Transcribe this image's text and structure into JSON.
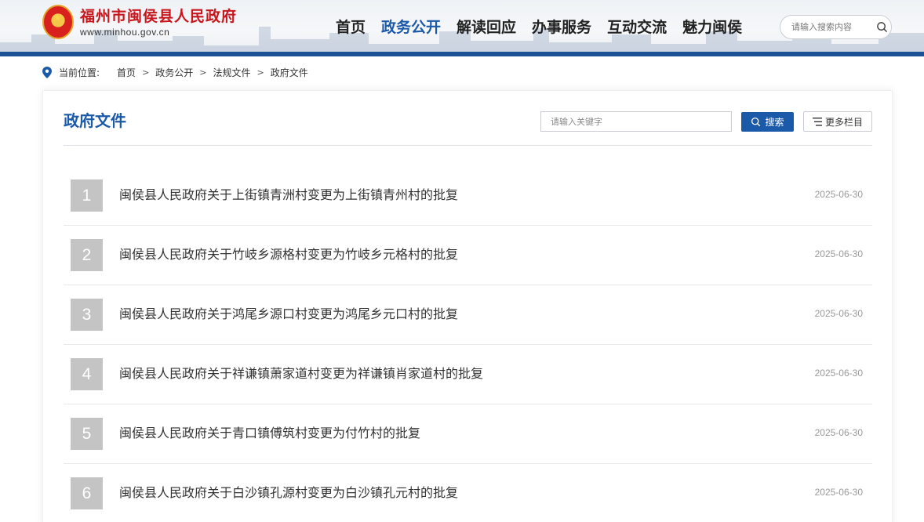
{
  "header": {
    "site_name_cn": "福州市闽侯县人民政府",
    "site_url": "www.minhou.gov.cn",
    "nav": [
      {
        "label": "首页",
        "active": false
      },
      {
        "label": "政务公开",
        "active": true
      },
      {
        "label": "解读回应",
        "active": false
      },
      {
        "label": "办事服务",
        "active": false
      },
      {
        "label": "互动交流",
        "active": false
      },
      {
        "label": "魅力闽侯",
        "active": false
      }
    ],
    "search_placeholder": "请输入搜索内容",
    "accent_color": "#1c5195"
  },
  "breadcrumb": {
    "prefix": "当前位置:",
    "items": [
      "首页",
      "政务公开",
      "法规文件",
      "政府文件"
    ],
    "separator": ">"
  },
  "main": {
    "title": "政府文件",
    "keyword_placeholder": "请输入关键字",
    "search_label": "搜索",
    "more_label": "更多栏目",
    "documents": [
      {
        "num": "1",
        "title": "闽侯县人民政府关于上街镇青洲村变更为上街镇青州村的批复",
        "date": "2025-06-30"
      },
      {
        "num": "2",
        "title": "闽侯县人民政府关于竹岐乡源格村变更为竹岐乡元格村的批复",
        "date": "2025-06-30"
      },
      {
        "num": "3",
        "title": "闽侯县人民政府关于鸿尾乡源口村变更为鸿尾乡元口村的批复",
        "date": "2025-06-30"
      },
      {
        "num": "4",
        "title": "闽侯县人民政府关于祥谦镇萧家道村变更为祥谦镇肖家道村的批复",
        "date": "2025-06-30"
      },
      {
        "num": "5",
        "title": "闽侯县人民政府关于青口镇傅筑村变更为付竹村的批复",
        "date": "2025-06-30"
      },
      {
        "num": "6",
        "title": "闽侯县人民政府关于白沙镇孔源村变更为白沙镇孔元村的批复",
        "date": "2025-06-30"
      }
    ]
  },
  "colors": {
    "primary": "#1b5aa8",
    "brand_red": "#c8161d",
    "number_badge": "#c4c4c4"
  },
  "icons": [
    "emblem-icon",
    "search-icon",
    "location-pin-icon",
    "list-icon"
  ]
}
